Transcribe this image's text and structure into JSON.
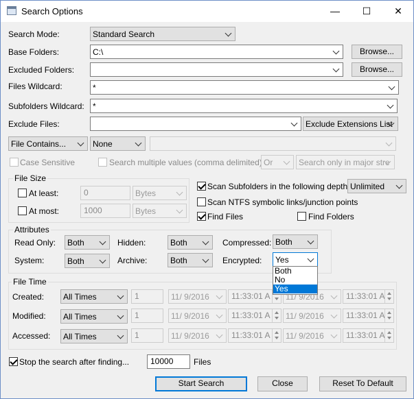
{
  "window": {
    "title": "Search Options",
    "minimize": "—",
    "maximize": "☐",
    "close": "✕"
  },
  "search_mode": {
    "label": "Search Mode:",
    "value": "Standard Search"
  },
  "base_folders": {
    "label": "Base Folders:",
    "value": "C:\\",
    "browse": "Browse..."
  },
  "excluded_folders": {
    "label": "Excluded Folders:",
    "value": "",
    "browse": "Browse..."
  },
  "files_wildcard": {
    "label": "Files Wildcard:",
    "value": "*"
  },
  "subfolders_wildcard": {
    "label": "Subfolders Wildcard:",
    "value": "*"
  },
  "exclude_files": {
    "label": "Exclude Files:",
    "value": "",
    "list": "Exclude Extensions List"
  },
  "contains": {
    "mode": "File Contains...",
    "type": "None",
    "text": ""
  },
  "case_sensitive": "Case Sensitive",
  "multiple_values": "Search multiple values (comma delimited)",
  "or_select": "Or",
  "stream_select": "Search only in major stre",
  "file_size": {
    "title": "File Size",
    "at_least": "At least:",
    "at_least_value": "0",
    "at_least_unit": "Bytes",
    "at_most": "At most:",
    "at_most_value": "1000",
    "at_most_unit": "Bytes"
  },
  "scan_subfolders": {
    "label": "Scan Subfolders in the following depth:",
    "value": "Unlimited"
  },
  "scan_ntfs": "Scan NTFS symbolic links/junction points",
  "find_files": "Find Files",
  "find_folders": "Find Folders",
  "attributes": {
    "title": "Attributes",
    "read_only": {
      "label": "Read Only:",
      "value": "Both"
    },
    "hidden": {
      "label": "Hidden:",
      "value": "Both"
    },
    "compressed": {
      "label": "Compressed:",
      "value": "Both"
    },
    "system": {
      "label": "System:",
      "value": "Both"
    },
    "archive": {
      "label": "Archive:",
      "value": "Both"
    },
    "encrypted": {
      "label": "Encrypted:",
      "value": "Yes",
      "options": [
        "Both",
        "No",
        "Yes"
      ]
    }
  },
  "file_time": {
    "title": "File Time",
    "rows": [
      {
        "label": "Created:",
        "mode": "All Times",
        "num": "1",
        "date1": "11/  9/2016",
        "time1": "11:33:01 A",
        "date2": "11/  9/2016",
        "time2": "11:33:01 A"
      },
      {
        "label": "Modified:",
        "mode": "All Times",
        "num": "1",
        "date1": "11/  9/2016",
        "time1": "11:33:01 A",
        "date2": "11/  9/2016",
        "time2": "11:33:01 A"
      },
      {
        "label": "Accessed:",
        "mode": "All Times",
        "num": "1",
        "date1": "11/  9/2016",
        "time1": "11:33:01 A",
        "date2": "11/  9/2016",
        "time2": "11:33:01 A"
      }
    ]
  },
  "stop_after": {
    "label": "Stop the search after finding...",
    "value": "10000",
    "unit": "Files"
  },
  "buttons": {
    "start": "Start Search",
    "close": "Close",
    "reset": "Reset To Default"
  }
}
